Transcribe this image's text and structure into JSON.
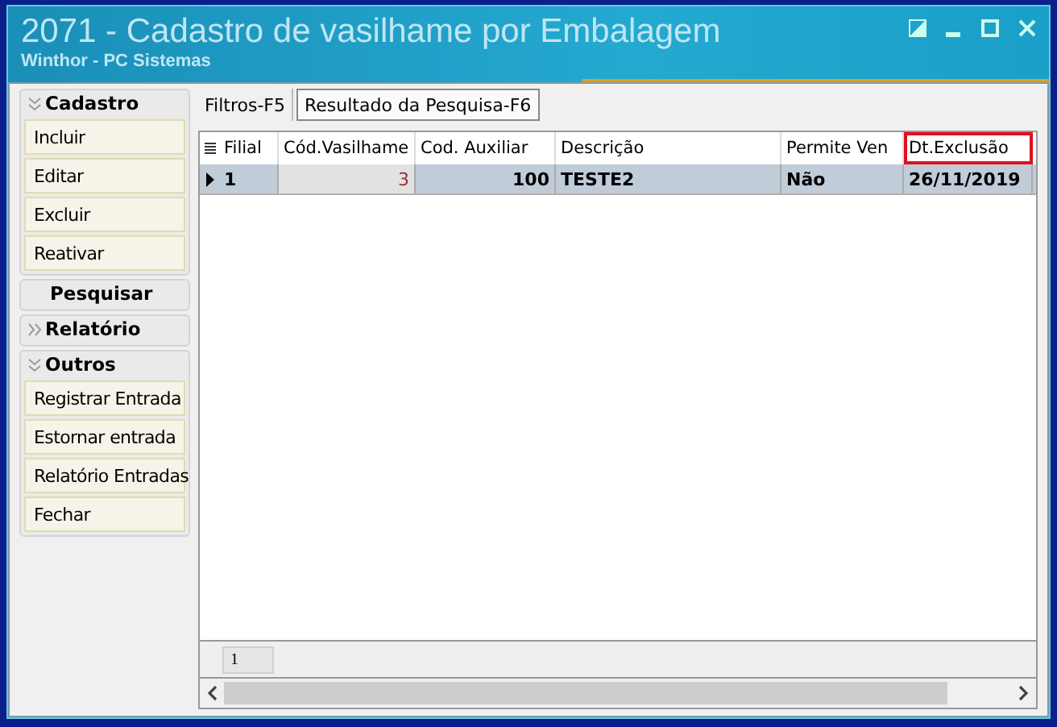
{
  "window": {
    "title": "2071 - Cadastro de vasilhame por Embalagem",
    "subtitle": "Winthor - PC Sistemas"
  },
  "sidebar": {
    "groups": [
      {
        "label": "Cadastro",
        "kind": "expandable",
        "expanded": true,
        "items": [
          "Incluir",
          "Editar",
          "Excluir",
          "Reativar"
        ]
      },
      {
        "label": "Pesquisar",
        "kind": "plain"
      },
      {
        "label": "Relatório",
        "kind": "expandable",
        "expanded": false
      },
      {
        "label": "Outros",
        "kind": "expandable",
        "expanded": true,
        "items": [
          "Registrar Entrada",
          "Estornar entrada",
          "Relatório Entradas",
          "Fechar"
        ]
      }
    ]
  },
  "tabs": [
    {
      "label": "Filtros-F5",
      "selected": false
    },
    {
      "label": "Resultado da Pesquisa-F6",
      "selected": true
    }
  ],
  "table": {
    "columns": [
      {
        "label": "Filial",
        "kind": "text",
        "highlighted": false
      },
      {
        "label": "Cód.Vasilhame",
        "kind": "number",
        "highlighted": false
      },
      {
        "label": "Cod. Auxiliar",
        "kind": "number",
        "highlighted": false
      },
      {
        "label": "Descrição",
        "kind": "text",
        "highlighted": false
      },
      {
        "label": "Permite Ven",
        "kind": "text",
        "highlighted": false
      },
      {
        "label": "Dt.Exclusão",
        "kind": "text",
        "highlighted": true
      }
    ],
    "rows": [
      {
        "selected": true,
        "cells": [
          {
            "text": "1",
            "focused": false
          },
          {
            "text": "3",
            "focused": true
          },
          {
            "text": "100",
            "focused": false
          },
          {
            "text": "TESTE2",
            "focused": false
          },
          {
            "text": "Não",
            "focused": false
          },
          {
            "text": "26/11/2019",
            "focused": false
          }
        ]
      }
    ],
    "footer": {
      "count": "1"
    }
  }
}
